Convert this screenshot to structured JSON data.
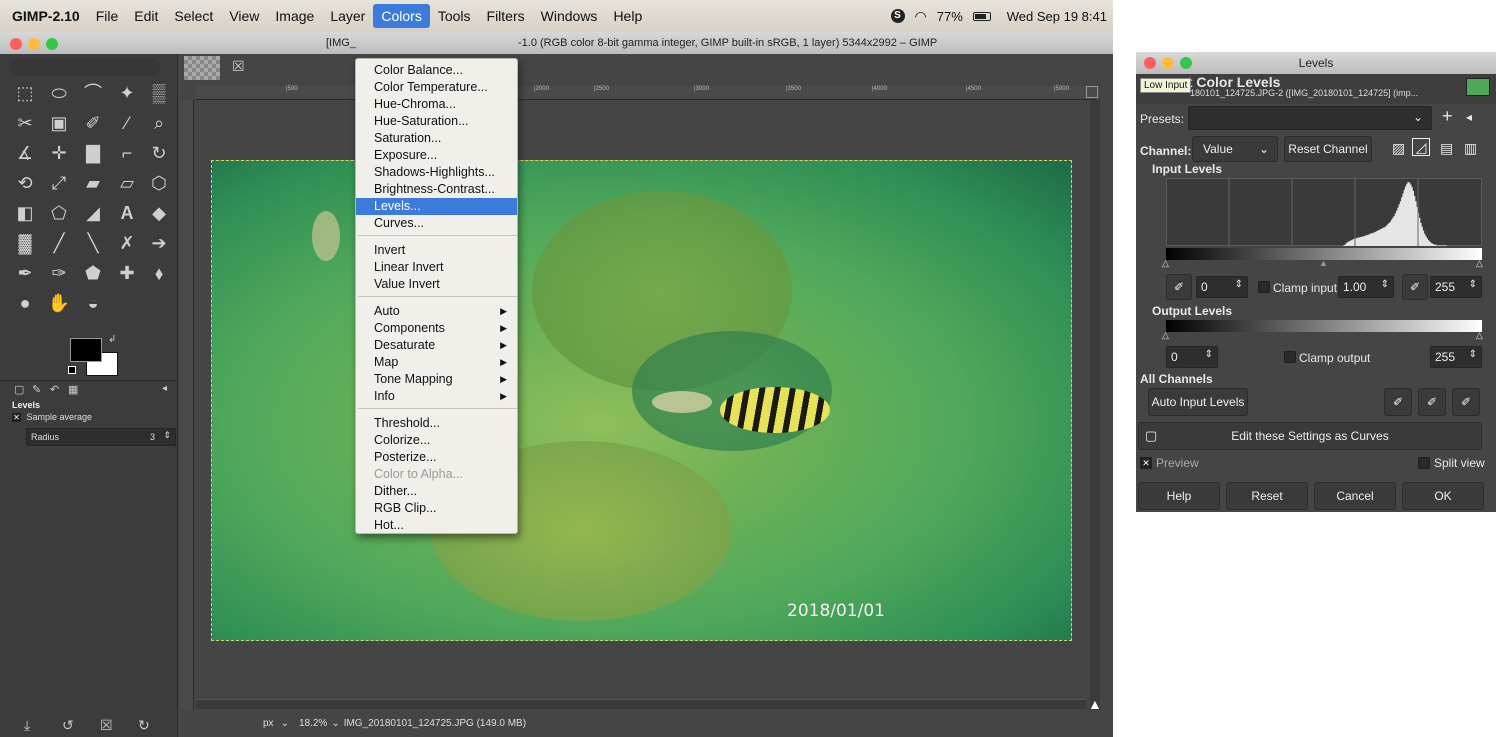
{
  "menubar": {
    "app": "GIMP-2.10",
    "items": [
      "File",
      "Edit",
      "Select",
      "View",
      "Image",
      "Layer",
      "Colors",
      "Tools",
      "Filters",
      "Windows",
      "Help"
    ],
    "battery": "77%",
    "clock": "Wed Sep 19 8:41"
  },
  "window": {
    "title_left": "[IMG_",
    "title_right": "-1.0 (RGB color 8-bit gamma integer, GIMP built-in sRGB, 1 layer) 5344x2992 – GIMP"
  },
  "ruler": {
    "ticks": [
      "|500",
      "|2000",
      "|2500",
      "|3000",
      "|3500",
      "|4000",
      "|4500",
      "|5000"
    ]
  },
  "colors_menu": {
    "items": [
      {
        "label": "Color Balance..."
      },
      {
        "label": "Color Temperature..."
      },
      {
        "label": "Hue-Chroma..."
      },
      {
        "label": "Hue-Saturation..."
      },
      {
        "label": "Saturation..."
      },
      {
        "label": "Exposure..."
      },
      {
        "label": "Shadows-Highlights..."
      },
      {
        "label": "Brightness-Contrast..."
      },
      {
        "label": "Levels..."
      },
      {
        "label": "Curves..."
      },
      {
        "label": "Invert"
      },
      {
        "label": "Linear Invert"
      },
      {
        "label": "Value Invert"
      },
      {
        "label": "Auto"
      },
      {
        "label": "Components"
      },
      {
        "label": "Desaturate"
      },
      {
        "label": "Map"
      },
      {
        "label": "Tone Mapping"
      },
      {
        "label": "Info"
      },
      {
        "label": "Threshold..."
      },
      {
        "label": "Colorize..."
      },
      {
        "label": "Posterize..."
      },
      {
        "label": "Color to Alpha..."
      },
      {
        "label": "Dither..."
      },
      {
        "label": "RGB Clip..."
      },
      {
        "label": "Hot..."
      }
    ],
    "selected": "Levels...",
    "disabled": "Color to Alpha..."
  },
  "tool_options": {
    "title": "Levels",
    "sample_average": "Sample average",
    "radius_label": "Radius",
    "radius_value": "3"
  },
  "image": {
    "date_stamp": "2018/01/01"
  },
  "statusbar": {
    "unit": "px",
    "zoom": "18.2%",
    "file_info": "IMG_20180101_124725.JPG (149.0 MB)"
  },
  "levels_dialog": {
    "window_title": "Levels",
    "tooltip": "Low Input",
    "heading": "st Color Levels",
    "subheading": "180101_124725.JPG-2 ([IMG_20180101_124725] (imp...",
    "presets_label": "Presets:",
    "channel_label": "Channel:",
    "channel_value": "Value",
    "reset_channel": "Reset Channel",
    "input_levels": "Input Levels",
    "input_low": "0",
    "clamp_input": "Clamp input",
    "gamma": "1.00",
    "input_high": "255",
    "output_levels": "Output Levels",
    "output_low": "0",
    "clamp_output": "Clamp output",
    "output_high": "255",
    "all_channels": "All Channels",
    "auto_input_levels": "Auto Input Levels",
    "edit_as_curves": "Edit these Settings as Curves",
    "preview": "Preview",
    "split_view": "Split view",
    "help": "Help",
    "reset": "Reset",
    "cancel": "Cancel",
    "ok": "OK"
  },
  "histogram": {
    "values": [
      0,
      0,
      0,
      0,
      0,
      0,
      0,
      0,
      0,
      0,
      0,
      0,
      0,
      0,
      0,
      0,
      0,
      0,
      0,
      0,
      0,
      0,
      0,
      0,
      0,
      0,
      0,
      0,
      0,
      0,
      0,
      0,
      0,
      0,
      0,
      0,
      0,
      0,
      0,
      0,
      0,
      0,
      0,
      0,
      0,
      0,
      0,
      0,
      0,
      0,
      0,
      0,
      0,
      0,
      0,
      0,
      0,
      0,
      0,
      0,
      0,
      0,
      0,
      0,
      0,
      0,
      0,
      0,
      0,
      0,
      0,
      0,
      0,
      0,
      0,
      0,
      0,
      0,
      0,
      0,
      0,
      0,
      0,
      0,
      0,
      0,
      0,
      0,
      0,
      0,
      0,
      0,
      0,
      0,
      0,
      0,
      0,
      0,
      0,
      0,
      0,
      0,
      0,
      0,
      0,
      0,
      0,
      0,
      0,
      0,
      0,
      0,
      0,
      0,
      0,
      0,
      0,
      0,
      0,
      0,
      0,
      0,
      0,
      0,
      0,
      0,
      0,
      0,
      0,
      0,
      0,
      0,
      0,
      0,
      0,
      0,
      0,
      0,
      0,
      0,
      0.01,
      0.02,
      0.04,
      0.06,
      0.07,
      0.08,
      0.09,
      0.1,
      0.11,
      0.12,
      0.12,
      0.13,
      0.13,
      0.14,
      0.14,
      0.15,
      0.15,
      0.16,
      0.17,
      0.17,
      0.18,
      0.19,
      0.2,
      0.2,
      0.21,
      0.22,
      0.23,
      0.24,
      0.25,
      0.26,
      0.27,
      0.28,
      0.29,
      0.3,
      0.32,
      0.34,
      0.36,
      0.38,
      0.41,
      0.44,
      0.47,
      0.51,
      0.55,
      0.6,
      0.65,
      0.7,
      0.76,
      0.82,
      0.88,
      0.93,
      0.97,
      1.0,
      0.99,
      0.96,
      0.92,
      0.86,
      0.78,
      0.7,
      0.61,
      0.52,
      0.44,
      0.36,
      0.3,
      0.24,
      0.19,
      0.15,
      0.12,
      0.09,
      0.07,
      0.05,
      0.04,
      0.03,
      0.02,
      0.02,
      0.01,
      0.01,
      0.01,
      0.01,
      0.01,
      0.01,
      0.01,
      0.01,
      0,
      0,
      0,
      0,
      0,
      0,
      0,
      0,
      0,
      0,
      0,
      0,
      0,
      0,
      0,
      0,
      0,
      0,
      0,
      0,
      0,
      0,
      0,
      0,
      0,
      0,
      0,
      0
    ]
  }
}
